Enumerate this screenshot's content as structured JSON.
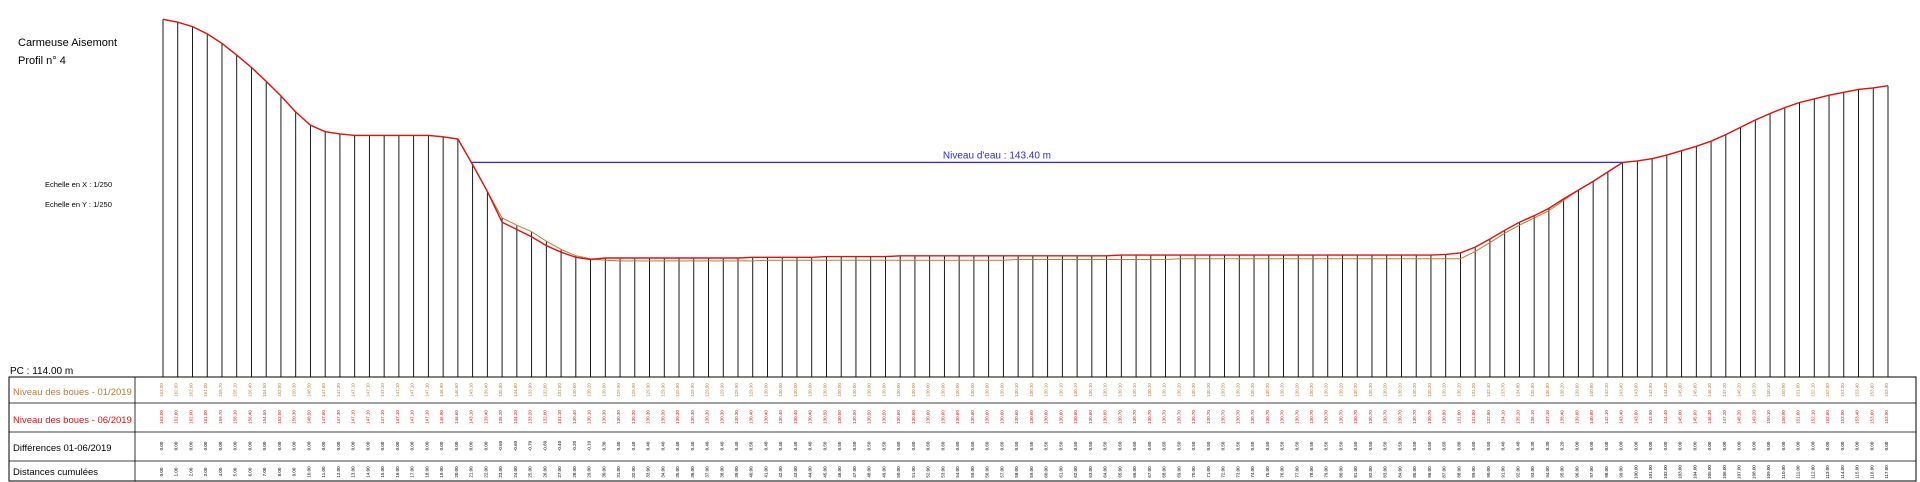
{
  "header": {
    "site": "Carmeuse Aisemont",
    "profile": "Profil n° 4"
  },
  "scales": {
    "x": "Echelle en X : 1/250",
    "y": "Echelle en Y : 1/250"
  },
  "reference": {
    "label": "PC : 114.00 m",
    "value_m": 114.0
  },
  "water": {
    "label": "Niveau d'eau : 143.40 m",
    "level_m": 143.4,
    "color": "#2a2ad8"
  },
  "colors": {
    "boues_2019_01": "#c07a30",
    "boues_2019_06": "#e01010",
    "stations": "#000000"
  },
  "table": {
    "rows": [
      {
        "label": "Niveau des boues - 01/2019",
        "color": "#c07a30"
      },
      {
        "label": "Niveau des boues - 06/2019",
        "color": "#e01010"
      },
      {
        "label": "Différences 01-06/2019",
        "color": "#000000"
      },
      {
        "label": "Distances cumulées",
        "color": "#000000"
      }
    ]
  },
  "profile_data": {
    "distance_m": [
      0.0,
      1.0,
      2.0,
      3.0,
      4.0,
      5.0,
      6.0,
      7.0,
      8.0,
      9.0,
      10.0,
      11.0,
      12.0,
      13.0,
      14.0,
      15.0,
      16.0,
      17.0,
      18.0,
      19.0,
      20.0,
      21.0,
      22.0,
      23.0,
      24.0,
      25.0,
      26.0,
      27.0,
      28.0,
      29.0,
      30.0,
      31.0,
      32.0,
      33.0,
      34.0,
      35.0,
      36.0,
      37.0,
      38.0,
      39.0,
      40.0,
      41.0,
      42.0,
      43.0,
      44.0,
      45.0,
      46.0,
      47.0,
      48.0,
      49.0,
      50.0,
      51.0,
      52.0,
      53.0,
      54.0,
      55.0,
      56.0,
      57.0,
      58.0,
      59.0,
      60.0,
      61.0,
      62.0,
      63.0,
      64.0,
      65.0,
      66.0,
      67.0,
      68.0,
      69.0,
      70.0,
      71.0,
      72.0,
      73.0,
      74.0,
      75.0,
      76.0,
      77.0,
      78.0,
      79.0,
      80.0,
      81.0,
      82.0,
      83.0,
      84.0,
      85.0,
      86.0,
      87.0,
      88.0,
      89.0,
      90.0,
      91.0,
      92.0,
      93.0,
      94.0,
      95.0,
      96.0,
      97.0,
      98.0,
      99.0,
      100.0,
      101.0,
      102.0,
      103.0,
      104.0,
      105.0,
      106.0,
      107.0,
      108.0,
      109.0,
      110.0,
      111.0,
      112.0,
      113.0,
      114.0,
      115.0,
      116.0,
      117.0
    ],
    "boues_2019_01": [
      163.0,
      162.6,
      162.0,
      161.0,
      159.7,
      158.1,
      156.4,
      154.5,
      152.5,
      150.3,
      148.5,
      147.6,
      147.3,
      147.1,
      147.1,
      147.1,
      147.1,
      147.1,
      147.1,
      146.9,
      146.6,
      143.1,
      139.4,
      135.8,
      134.8,
      133.9,
      132.6,
      131.5,
      130.6,
      130.2,
      130.0,
      129.9,
      129.9,
      129.9,
      129.9,
      129.9,
      129.9,
      129.9,
      129.9,
      129.9,
      129.9,
      130.0,
      130.0,
      130.0,
      130.0,
      130.0,
      130.0,
      130.0,
      130.0,
      130.0,
      130.0,
      130.0,
      130.0,
      130.0,
      130.0,
      130.0,
      130.0,
      130.0,
      130.1,
      130.1,
      130.1,
      130.1,
      130.1,
      130.1,
      130.1,
      130.1,
      130.1,
      130.1,
      130.1,
      130.2,
      130.2,
      130.2,
      130.2,
      130.2,
      130.2,
      130.2,
      130.2,
      130.2,
      130.2,
      130.2,
      130.2,
      130.2,
      130.2,
      130.2,
      130.2,
      130.2,
      130.2,
      130.2,
      130.2,
      131.2,
      132.4,
      133.7,
      134.8,
      135.8,
      136.8,
      138.2,
      139.6,
      140.8,
      142.1,
      143.4,
      143.6,
      143.9,
      144.4,
      145.0,
      145.6,
      146.3,
      147.2,
      148.2,
      149.2,
      150.1,
      150.9,
      151.6,
      152.1,
      152.6,
      153.0,
      153.4,
      153.6,
      153.9
    ],
    "boues_2019_06": [
      163.0,
      162.6,
      162.0,
      161.0,
      159.7,
      158.1,
      156.4,
      154.5,
      152.5,
      150.3,
      148.5,
      147.6,
      147.3,
      147.1,
      147.1,
      147.1,
      147.1,
      147.1,
      147.1,
      146.9,
      146.6,
      143.1,
      139.4,
      135.2,
      134.2,
      133.2,
      132.0,
      131.1,
      130.4,
      130.1,
      130.3,
      130.3,
      130.3,
      130.3,
      130.3,
      130.3,
      130.3,
      130.3,
      130.3,
      130.3,
      130.4,
      130.4,
      130.4,
      130.4,
      130.4,
      130.5,
      130.5,
      130.5,
      130.5,
      130.5,
      130.6,
      130.6,
      130.6,
      130.6,
      130.6,
      130.6,
      130.6,
      130.6,
      130.6,
      130.6,
      130.6,
      130.6,
      130.6,
      130.6,
      130.6,
      130.7,
      130.7,
      130.7,
      130.7,
      130.7,
      130.7,
      130.7,
      130.7,
      130.7,
      130.7,
      130.7,
      130.7,
      130.7,
      130.7,
      130.7,
      130.7,
      130.7,
      130.7,
      130.7,
      130.7,
      130.7,
      130.7,
      130.8,
      131.0,
      131.8,
      132.9,
      134.1,
      135.2,
      136.1,
      137.1,
      138.4,
      139.6,
      140.8,
      142.1,
      143.4,
      143.6,
      143.9,
      144.4,
      145.0,
      145.6,
      146.3,
      147.2,
      148.2,
      149.2,
      150.1,
      150.9,
      151.6,
      152.1,
      152.6,
      153.0,
      153.4,
      153.6,
      153.9
    ]
  }
}
